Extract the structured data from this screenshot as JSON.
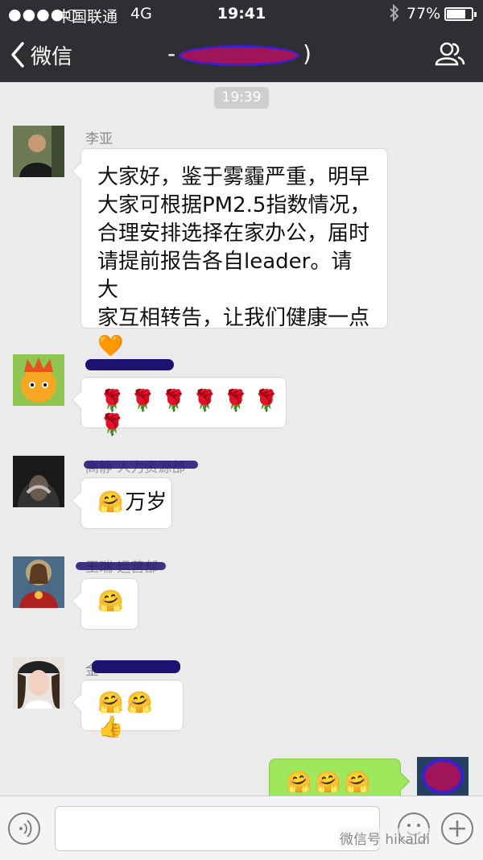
{
  "status_bar": {
    "signal": "●●●●○",
    "carrier": "中国联通",
    "network": "4G",
    "time": "19:41",
    "battery_percent_label": "77%",
    "battery_level": 0.77
  },
  "nav": {
    "back_label": "微信",
    "title_suffix": ")"
  },
  "chat": {
    "timestamp": "19:39",
    "messages": [
      {
        "sender": "李亚",
        "lines": [
          "大家好，鉴于雾霾严重，明早",
          "大家可根据PM2.5指数情况，",
          "合理安排选择在家办公，届时",
          "请提前报告各自leader。请大",
          "家互相转告，让我们健康一点"
        ],
        "emoji": "🧡"
      },
      {
        "sender": "",
        "emoji": "🌹🌹🌹🌹🌹🌹🌹"
      },
      {
        "sender": "高静 人力资源部",
        "emoji": "🤗",
        "text": "万岁"
      },
      {
        "sender": "王瑞 运营部",
        "emoji": "🤗"
      },
      {
        "sender": "金",
        "emoji": "🤗🤗👍"
      },
      {
        "sender": "",
        "emoji": "🤗🤗🤗🤗",
        "mine": true
      }
    ]
  },
  "input_bar": {
    "placeholder": "",
    "watermark": "微信号 hikaldi"
  },
  "colors": {
    "header_bg": "#2f2f33",
    "chat_bg": "#ebebeb",
    "my_bubble": "#9fe75d",
    "redaction": "#1d1270"
  },
  "icons": [
    "back-chevron-icon",
    "contacts-icon",
    "voice-icon",
    "emoji-face-icon",
    "plus-icon",
    "bluetooth-icon",
    "battery-icon"
  ]
}
